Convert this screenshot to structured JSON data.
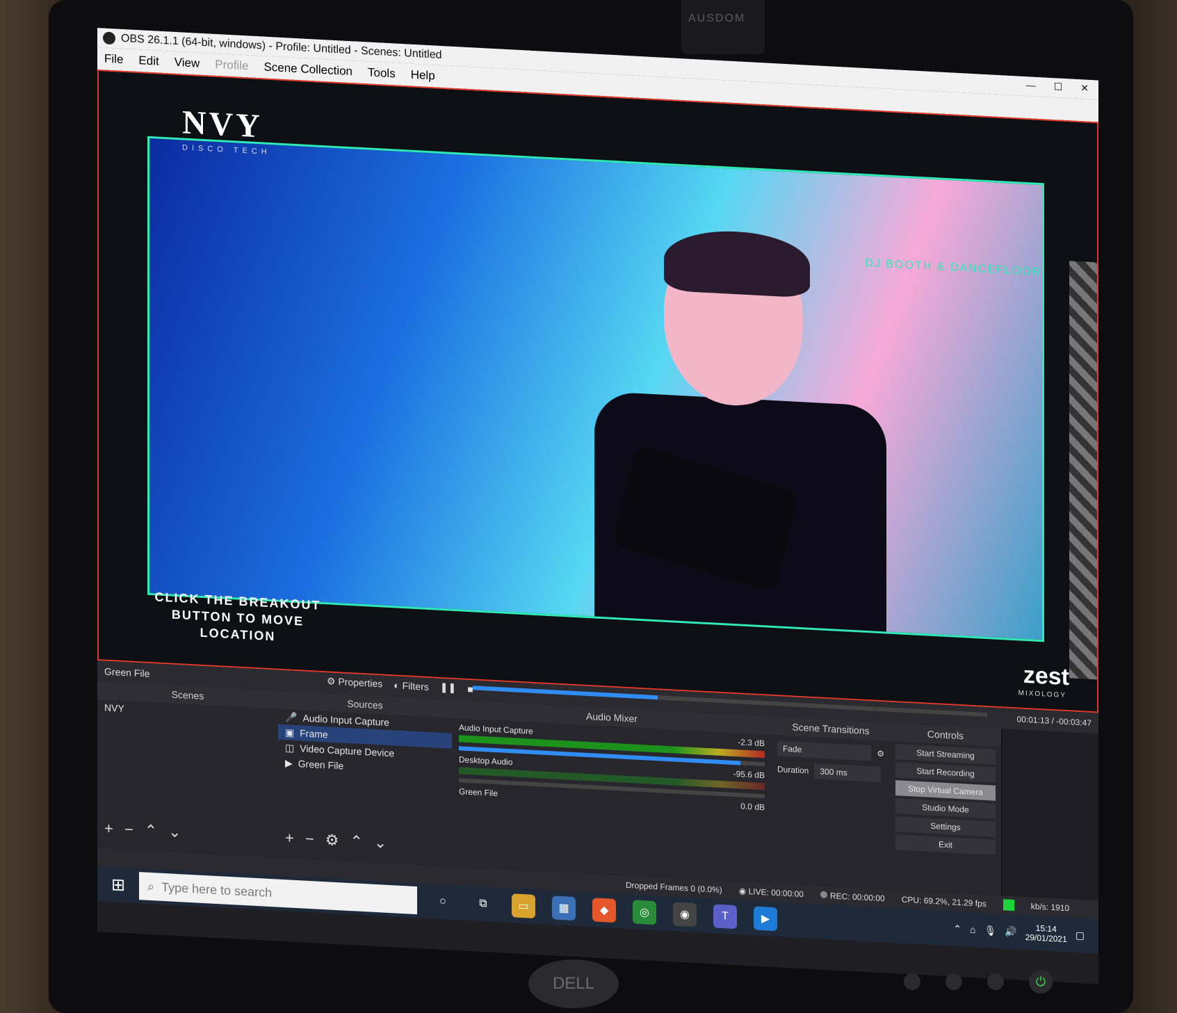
{
  "window": {
    "title": "OBS 26.1.1 (64-bit, windows) - Profile: Untitled - Scenes: Untitled",
    "controls": [
      "—",
      "☐",
      "✕"
    ]
  },
  "menu": {
    "items": [
      "File",
      "Edit",
      "View",
      "Profile",
      "Scene Collection",
      "Tools",
      "Help"
    ],
    "disabled": [
      "Profile"
    ]
  },
  "preview": {
    "brand": "NVY",
    "brand_sub": "DISCO TECH",
    "top_right_label": "DJ BOOTH & DANCEFLOOR",
    "breakout_text": "CLICK THE BREAKOUT BUTTON TO MOVE LOCATION",
    "sponsor": "zest",
    "sponsor_sub": "MIXOLOGY"
  },
  "source_toolbar": {
    "selected_source": "Green File",
    "properties": "Properties",
    "filters": "Filters",
    "media_progress": 0.36,
    "time": "00:01:13 / -00:03:47"
  },
  "scenes": {
    "title": "Scenes",
    "items": [
      "NVY"
    ]
  },
  "sources": {
    "title": "Sources",
    "items": [
      {
        "name": "Audio Input Capture",
        "icon": "mic-icon"
      },
      {
        "name": "Frame",
        "icon": "image-icon"
      },
      {
        "name": "Video Capture Device",
        "icon": "camera-icon"
      },
      {
        "name": "Green File",
        "icon": "play-icon"
      }
    ],
    "selected": "Frame"
  },
  "audio_mixer": {
    "title": "Audio Mixer",
    "tracks": [
      {
        "name": "Audio Input Capture",
        "db": "-2.3 dB",
        "level": 0.92
      },
      {
        "name": "Desktop Audio",
        "db": "-95.6 dB",
        "level": 0.0
      },
      {
        "name": "Green File",
        "db": "0.0 dB",
        "level": 1.0
      }
    ]
  },
  "scene_transitions": {
    "title": "Scene Transitions",
    "type": "Fade",
    "duration_label": "Duration",
    "duration": "300 ms"
  },
  "controls": {
    "title": "Controls",
    "buttons": [
      "Start Streaming",
      "Start Recording",
      "Stop Virtual Camera",
      "Studio Mode",
      "Settings",
      "Exit"
    ],
    "active": "Stop Virtual Camera"
  },
  "status": {
    "dropped": "Dropped Frames 0 (0.0%)",
    "live": "LIVE: 00:00:00",
    "rec": "REC: 00:00:00",
    "cpu": "CPU: 69.2%, 21.29 fps",
    "kbps": "kb/s: 1910"
  },
  "taskbar": {
    "search_placeholder": "Type here to search",
    "time": "15:14",
    "date": "29/01/2021"
  },
  "webcam_brand": "AUSDOM",
  "monitor_brand": "DELL"
}
